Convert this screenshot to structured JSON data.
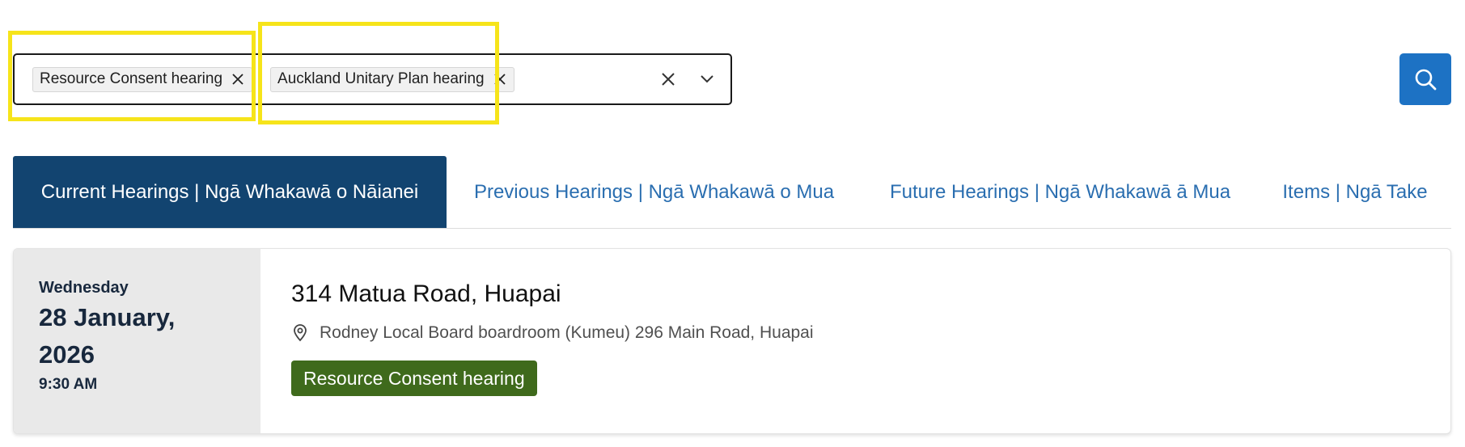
{
  "filter": {
    "chips": [
      {
        "label": "Resource Consent hearing"
      },
      {
        "label": "Auckland Unitary Plan hearing"
      }
    ],
    "clear_icon": "close-icon",
    "dropdown_icon": "chevron-down-icon"
  },
  "search_button": {
    "icon": "search-icon",
    "color": "#1d72c4"
  },
  "tabs": [
    {
      "label": "Current Hearings | Ngā Whakawā o Nāianei",
      "active": true
    },
    {
      "label": "Previous Hearings | Ngā Whakawā o Mua",
      "active": false
    },
    {
      "label": "Future Hearings | Ngā Whakawā ā Mua",
      "active": false
    },
    {
      "label": "Items | Ngā Take",
      "active": false
    }
  ],
  "hearing": {
    "weekday": "Wednesday",
    "date": "28 January, 2026",
    "time": "9:30 AM",
    "title": "314 Matua Road, Huapai",
    "venue": "Rodney Local Board boardroom (Kumeu) 296 Main Road, Huapai",
    "venue_icon": "map-pin-icon",
    "type_badge": "Resource Consent hearing"
  },
  "colors": {
    "active_tab": "#124470",
    "tab_link": "#2a6eb0",
    "badge": "#3f6a1c",
    "highlight": "#f6e41a"
  }
}
